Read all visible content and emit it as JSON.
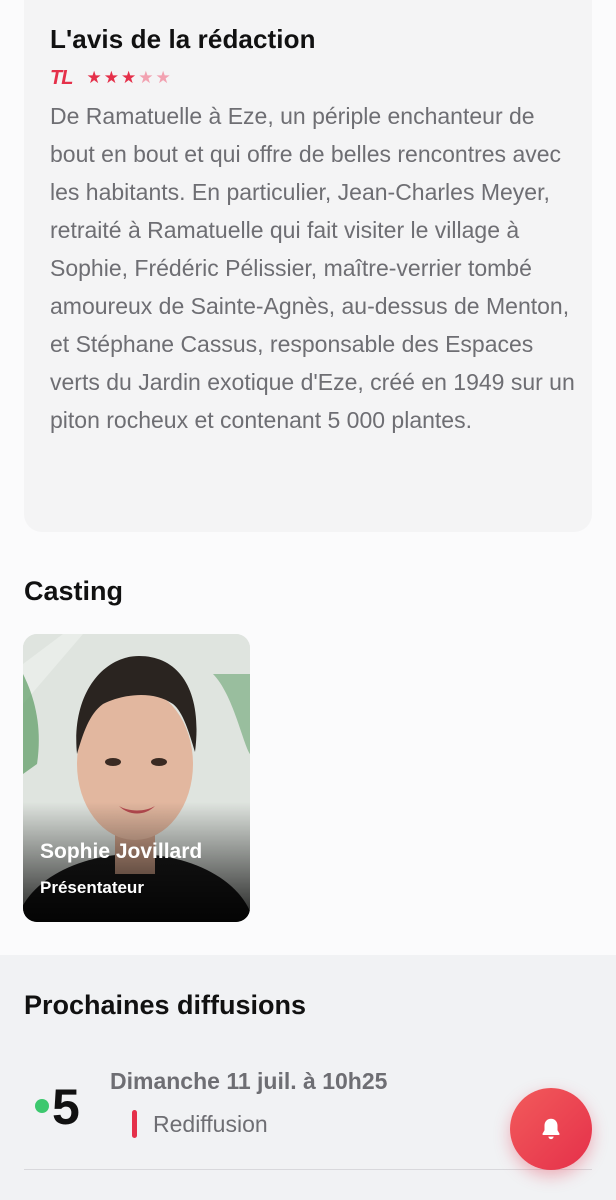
{
  "review": {
    "title": "L'avis de la rédaction",
    "source_logo": "TL",
    "rating": 3,
    "rating_max": 5,
    "text": "De Ramatuelle à Eze, un périple enchanteur de bout en bout et qui offre de belles rencontres avec les habitants. En particulier, Jean-Charles Meyer, retraité à Ramatuelle qui fait visiter le village à Sophie, Frédéric Pélissier, maître-verrier tombé amoureux de Sainte-Agnès, au-dessus de Menton, et Stéphane Cassus, responsable des Espaces verts du Jardin exotique d'Eze, créé en 1949 sur un piton rocheux et contenant 5 000 plantes."
  },
  "casting": {
    "title": "Casting",
    "members": [
      {
        "name": "Sophie Jovillard",
        "role": "Présentateur"
      }
    ]
  },
  "upcoming": {
    "title": "Prochaines diffusions",
    "items": [
      {
        "channel_icon": "france-5-logo",
        "channel_label": "5",
        "date": "Dimanche 11 juil. à 10h25",
        "tag": "Rediffusion"
      }
    ]
  },
  "fab": {
    "icon": "bell-icon"
  },
  "colors": {
    "accent": "#e5304a",
    "star_off": "#f2a2b1",
    "text_secondary": "#6e6e73",
    "card_bg": "#f4f4f5",
    "section_bg": "#f1f2f4",
    "channel_dot": "#3cc86e"
  }
}
